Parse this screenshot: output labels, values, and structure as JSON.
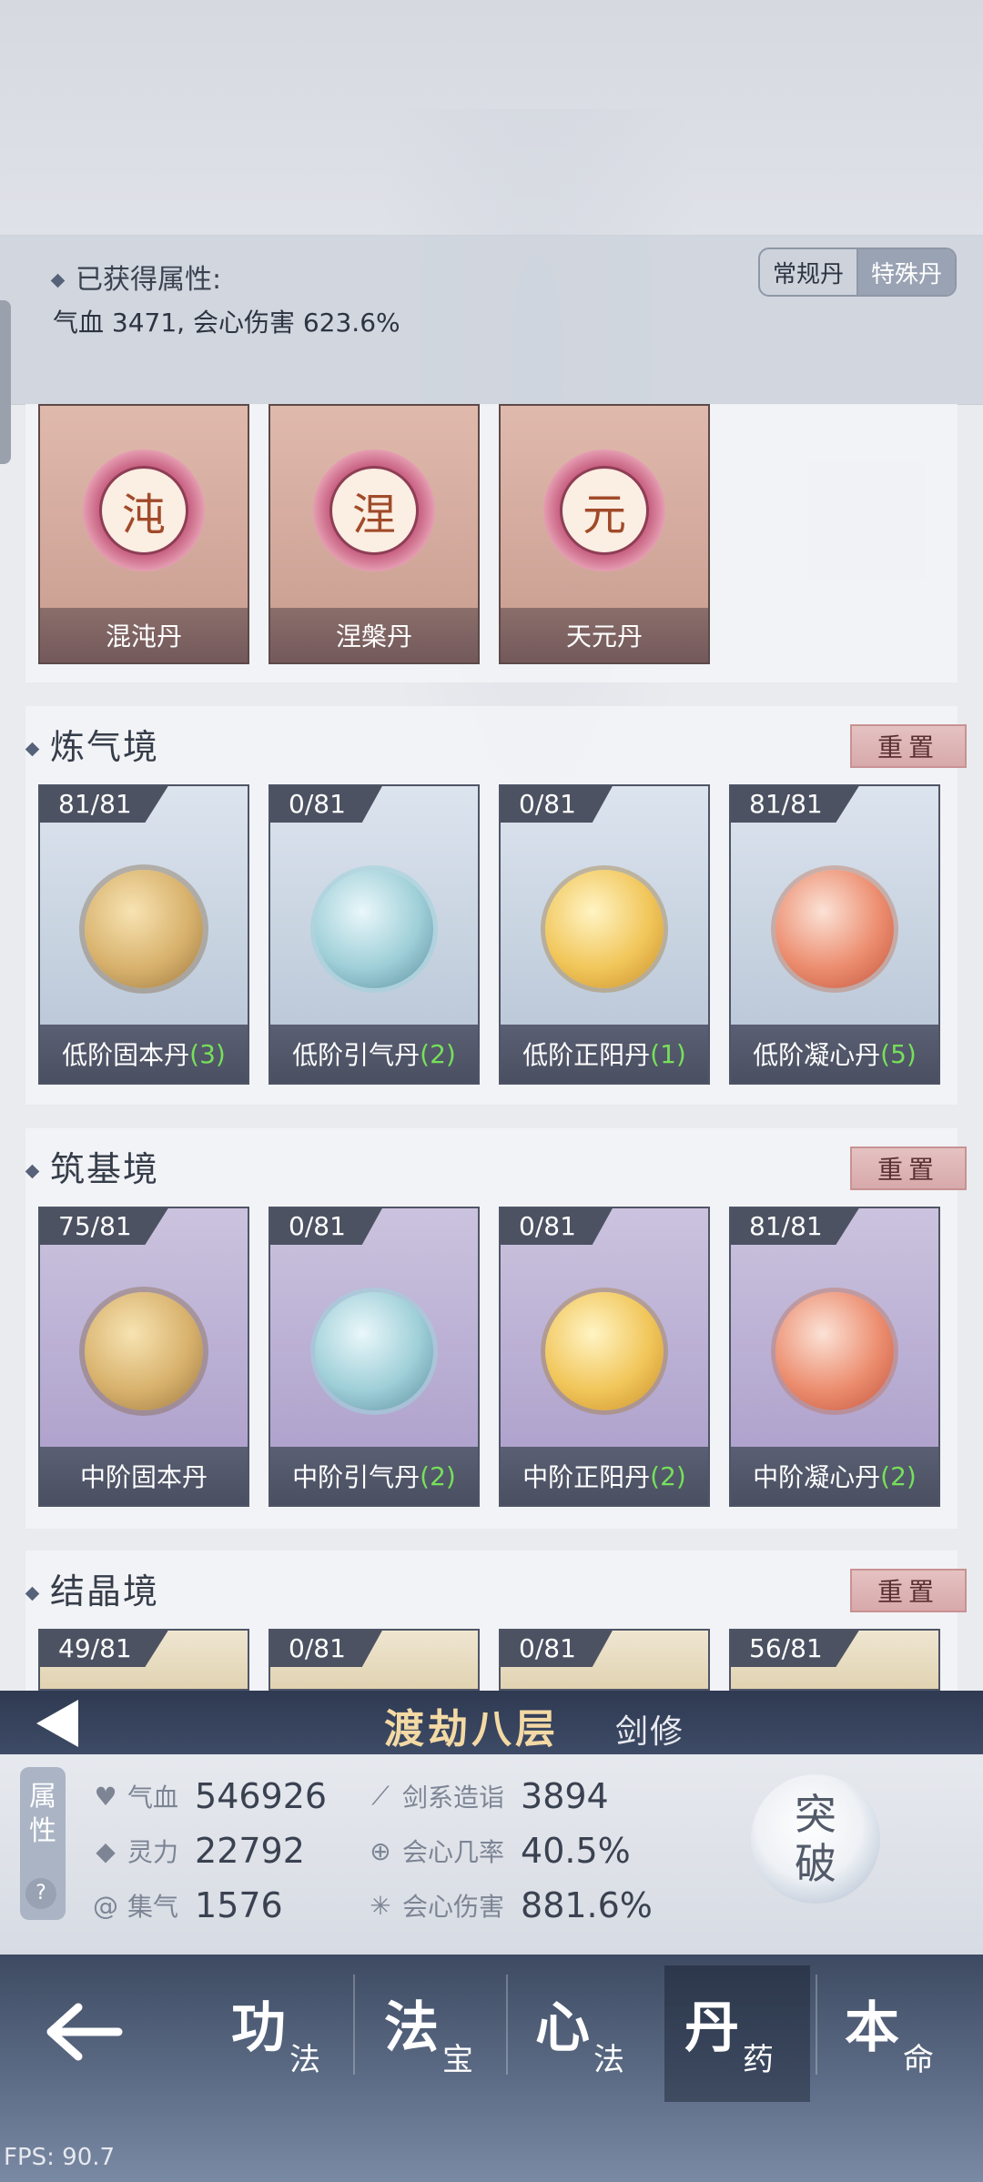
{
  "header": {
    "title": "已获得属性:",
    "values": "气血 3471, 会心伤害 623.6%",
    "tabs": [
      "常规丹",
      "特殊丹"
    ]
  },
  "special_pills": [
    {
      "seal": "沌",
      "name": "混沌丹"
    },
    {
      "seal": "涅",
      "name": "涅槃丹"
    },
    {
      "seal": "元",
      "name": "天元丹"
    }
  ],
  "sections": [
    {
      "title": "炼气境",
      "reset": "重置",
      "cards": [
        {
          "count": "81/81",
          "name": "低阶固本丹",
          "qty": "(3)"
        },
        {
          "count": "0/81",
          "name": "低阶引气丹",
          "qty": "(2)"
        },
        {
          "count": "0/81",
          "name": "低阶正阳丹",
          "qty": "(1)"
        },
        {
          "count": "81/81",
          "name": "低阶凝心丹",
          "qty": "(5)"
        }
      ]
    },
    {
      "title": "筑基境",
      "reset": "重置",
      "cards": [
        {
          "count": "75/81",
          "name": "中阶固本丹",
          "qty": ""
        },
        {
          "count": "0/81",
          "name": "中阶引气丹",
          "qty": "(2)"
        },
        {
          "count": "0/81",
          "name": "中阶正阳丹",
          "qty": "(2)"
        },
        {
          "count": "81/81",
          "name": "中阶凝心丹",
          "qty": "(2)"
        }
      ]
    },
    {
      "title": "结晶境",
      "reset": "重置",
      "cards": [
        {
          "count": "49/81"
        },
        {
          "count": "0/81"
        },
        {
          "count": "0/81"
        },
        {
          "count": "56/81"
        }
      ]
    }
  ],
  "character": {
    "realm": "渡劫八层",
    "class": "剑修"
  },
  "stats": {
    "pill_label": [
      "属",
      "性"
    ],
    "help": "?",
    "left": [
      {
        "icon": "heart-icon",
        "label": "气血",
        "value": "546926"
      },
      {
        "icon": "drop-icon",
        "label": "灵力",
        "value": "22792"
      },
      {
        "icon": "swirl-icon",
        "label": "集气",
        "value": "1576"
      }
    ],
    "right": [
      {
        "icon": "sword-icon",
        "label": "剑系造诣",
        "value": "3894"
      },
      {
        "icon": "crit-rate-icon",
        "label": "会心几率",
        "value": "40.5%"
      },
      {
        "icon": "burst-icon",
        "label": "会心伤害",
        "value": "881.6%"
      }
    ],
    "breakthrough": [
      "突",
      "破"
    ]
  },
  "nav": {
    "items": [
      {
        "big": "功",
        "small": "法"
      },
      {
        "big": "法",
        "small": "宝"
      },
      {
        "big": "心",
        "small": "法"
      },
      {
        "big": "丹",
        "small": "药"
      },
      {
        "big": "本",
        "small": "命"
      }
    ],
    "active_index": 3
  },
  "fps": "FPS: 90.7"
}
